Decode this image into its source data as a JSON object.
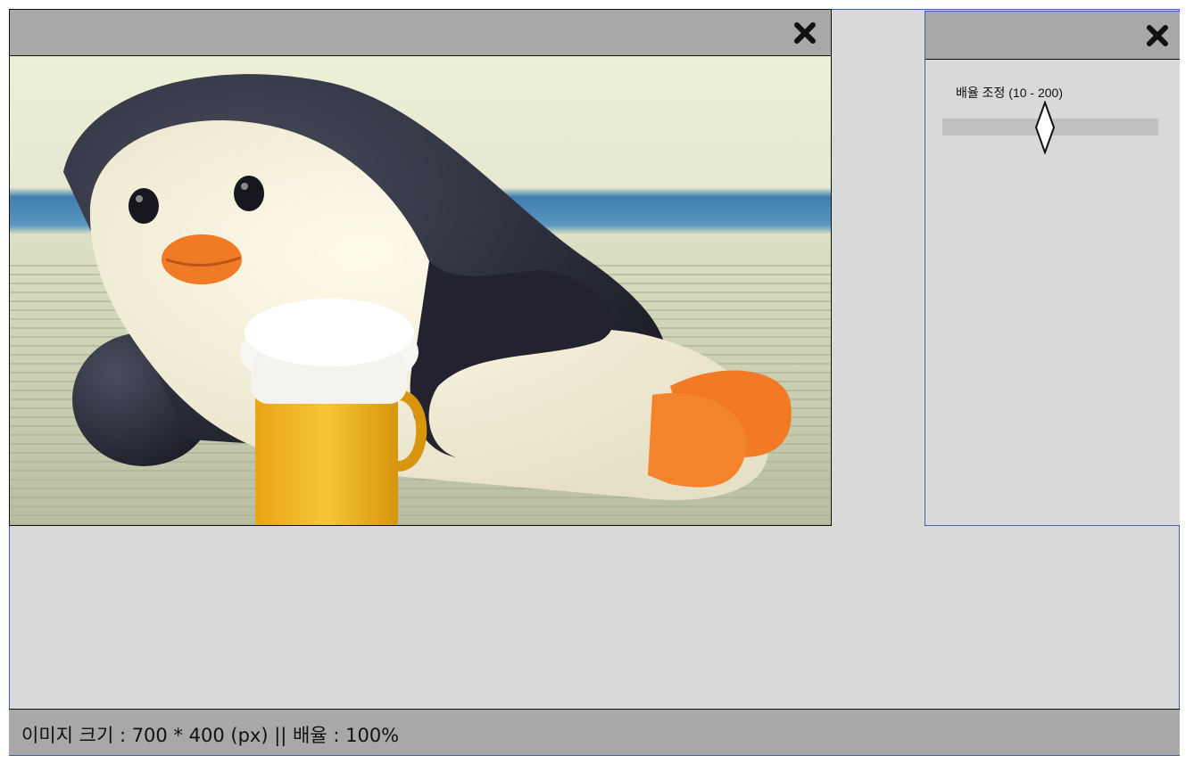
{
  "image_window": {
    "close_icon": "close-x-icon",
    "image_subject": "penguin figurine lying on tatami holding a mug"
  },
  "zoom_panel": {
    "close_icon": "close-x-icon",
    "label": "배율 조정 (10 - 200)",
    "slider": {
      "min": 10,
      "max": 200,
      "value": 100
    }
  },
  "statusbar": {
    "text": "이미지 크기 : 700 * 400 (px)  || 배율 : 100%"
  },
  "colors": {
    "background": "#d9d9d9",
    "titlebar": "#a8a8a8",
    "border_accent": "#3f5fae",
    "slider_track": "#c0c0c0"
  }
}
